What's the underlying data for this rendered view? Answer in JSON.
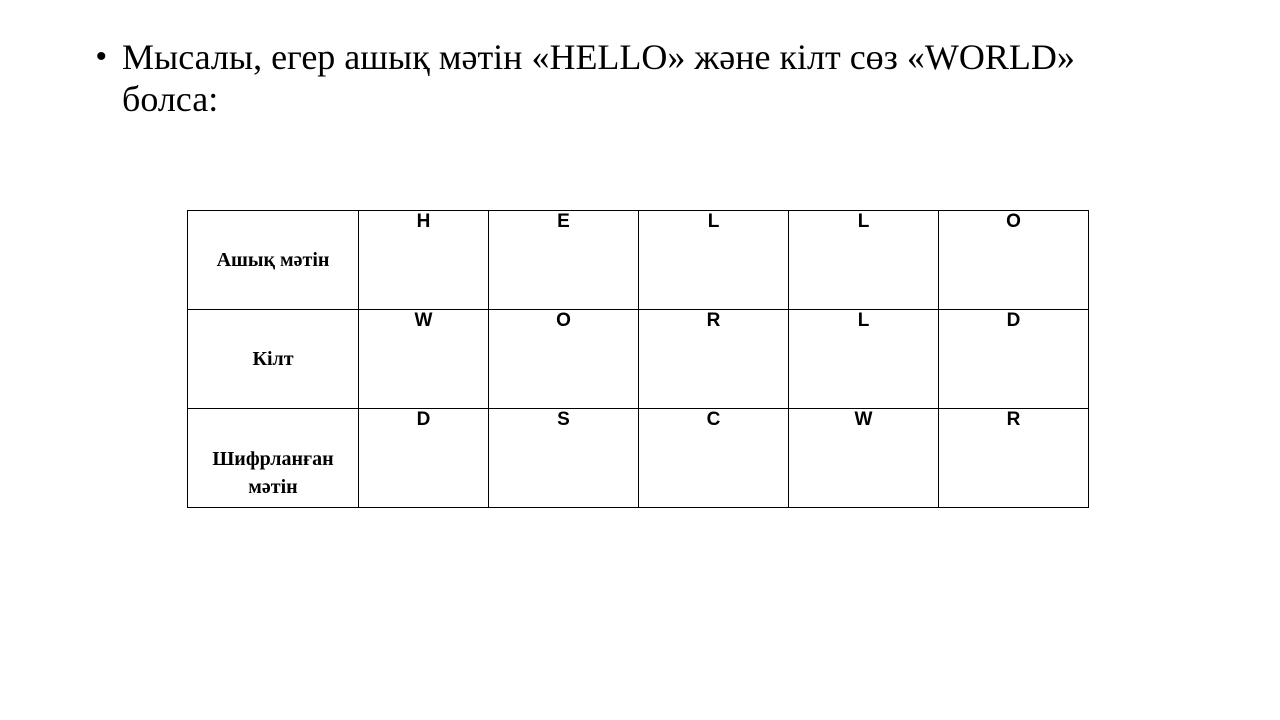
{
  "slide": {
    "bullet_glyph": "•",
    "bullet_text": "Мысалы, егер ашық мәтін «HELLO» және кілт сөз «WORLD» болса:"
  },
  "table": {
    "rows": [
      {
        "header": "Ашық мәтін",
        "cells": [
          "H",
          "E",
          "L",
          "L",
          "O"
        ]
      },
      {
        "header": "Кілт",
        "cells": [
          "W",
          "O",
          "R",
          "L",
          "D"
        ]
      },
      {
        "header": "Шифрланған мәтін",
        "cells": [
          "D",
          "S",
          "C",
          "W",
          "R"
        ]
      }
    ]
  }
}
